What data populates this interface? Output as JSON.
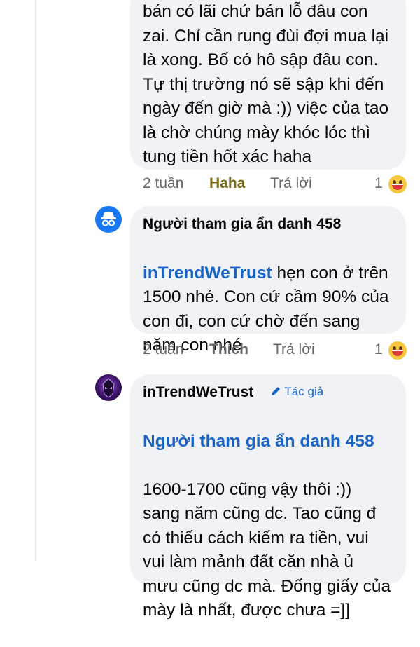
{
  "comment1": {
    "text": "bán có lãi chứ bán lỗ đâu con\nzai. Chỉ cần rung đùi đợi mua lại\nlà xong. Bố có hô sập đâu con.\nTự thị trường nó sẽ sập khi đến\nngày đến giờ mà :)) việc của tao\nlà chờ chúng mày khóc lóc thì\ntung tiền hốt xác haha",
    "time": "2 tuần",
    "reaction_label": "Haha",
    "reply_label": "Trả lời",
    "reaction_count": "1",
    "reaction_icon": "haha-emoji-icon",
    "reaction_color": "#7a6a1a"
  },
  "comment2": {
    "author": "Người tham gia ẩn danh 458",
    "mention": "inTrendWeTrust",
    "text_first": " hẹn con ở trên",
    "text_rest": "1500 nhé. Con cứ cầm 90% của\ncon đi, con cứ chờ đến sang\nnăm con nhé",
    "time": "2 tuần",
    "like_label": "Thích",
    "reply_label": "Trả lời",
    "reaction_count": "1",
    "avatar_icon": "anonymous-avatar-icon",
    "avatar_color": "#1877f2"
  },
  "comment3": {
    "author": "inTrendWeTrust",
    "badge_label": "Tác giả",
    "badge_icon": "pencil-icon",
    "mention": "Người tham gia ẩn danh 458",
    "text": "1600-1700 cũng vậy thôi :))\nsang năm cũng dc. Tao cũng đ\ncó thiếu cách kiếm ra tiền, vui\nvui làm mảnh đất căn nhà ủ\nmưu cũng dc mà. Đống giấy của\nmày là nhất, được chưa =]]",
    "avatar_icon": "author-avatar-icon"
  },
  "colors": {
    "bubble": "#f0f2f5",
    "link": "#1b63c4",
    "muted": "#65676b"
  }
}
